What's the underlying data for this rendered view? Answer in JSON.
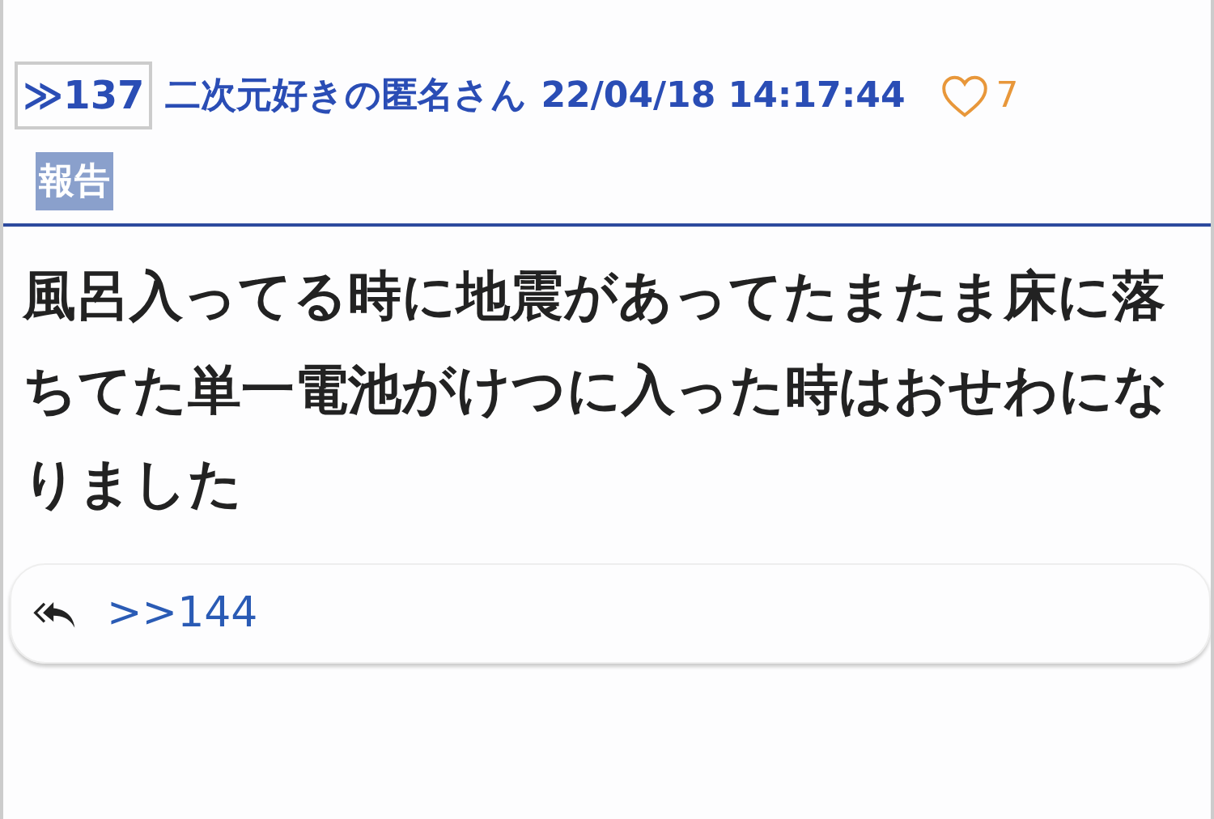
{
  "post": {
    "number": "≫137",
    "author": "二次元好きの匿名さん",
    "timestamp": "22/04/18 14:17:44",
    "likes": "7",
    "report_button": "報告",
    "body": "風呂入ってる時に地震があってたまたま床に落ちてた単一電池がけつに入った時はおせわになりました"
  },
  "replies": [
    {
      "link": ">>144"
    }
  ]
}
